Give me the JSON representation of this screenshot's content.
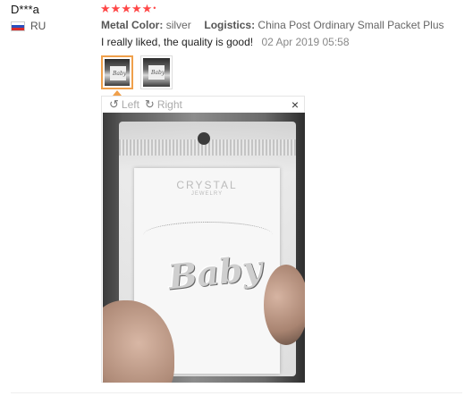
{
  "reviewer": {
    "name": "D***a",
    "country": "RU",
    "flag_icon": "russia-flag-icon"
  },
  "rating": {
    "stars": 5,
    "max": 5
  },
  "attributes": [
    {
      "key": "Metal Color:",
      "value": "silver"
    },
    {
      "key": "Logistics:",
      "value": "China Post Ordinary Small Packet Plus"
    }
  ],
  "review": {
    "text": "I really liked, the quality is good!",
    "date": "02 Apr 2019 05:58"
  },
  "thumbnails": [
    {
      "text": "Baby",
      "active": true
    },
    {
      "text": "Baby",
      "active": false
    }
  ],
  "viewer": {
    "rotate_left": "Left",
    "rotate_right": "Right",
    "close": "×",
    "photo": {
      "brand": "CRYSTAL",
      "brand_sub": "JEWELRY",
      "necklace_text": "Baby"
    }
  },
  "colors": {
    "star": "#ff4747",
    "active_thumb_border": "#f0a04b"
  }
}
